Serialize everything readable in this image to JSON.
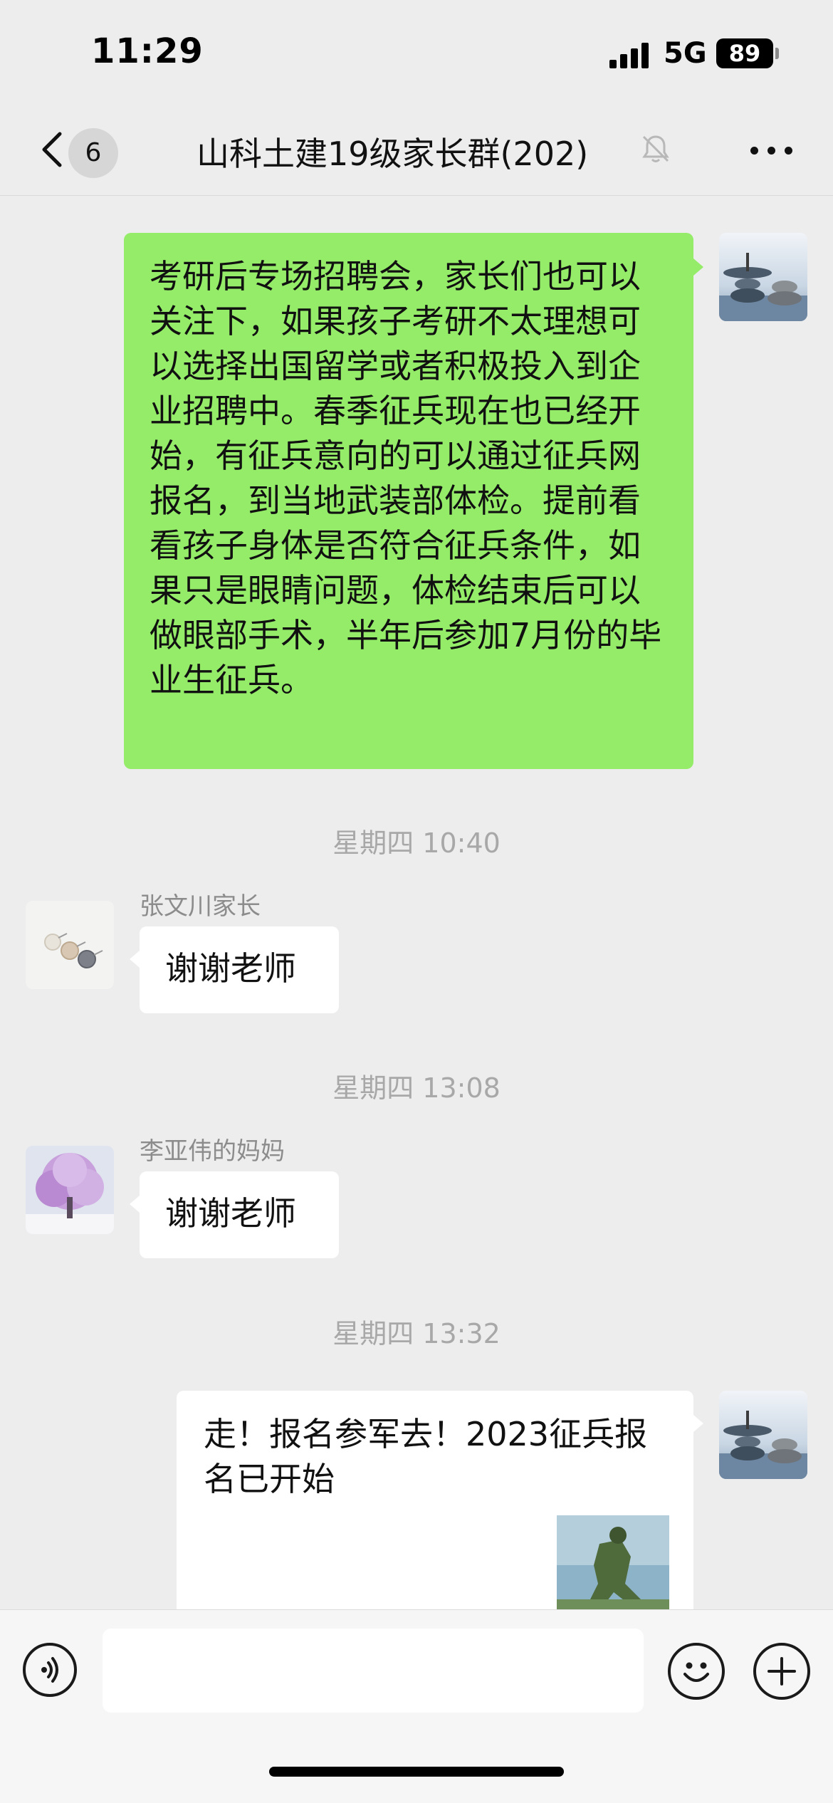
{
  "status_bar": {
    "time": "11:29",
    "network": "5G",
    "battery": "89"
  },
  "header": {
    "unread_count": "6",
    "title": "山科土建19级家长群(202)",
    "muted": true
  },
  "messages": [
    {
      "side": "right",
      "avatar": "stacked-stones-avatar",
      "text": "考研后专场招聘会，家长们也可以关注下，如果孩子考研不太理想可以选择出国留学或者积极投入到企业招聘中。春季征兵现在也已经开始，有征兵意向的可以通过征兵网报名，到当地武装部体检。提前看看孩子身体是否符合征兵条件，如果只是眼睛问题，体检结束后可以做眼部手术，半年后参加7月份的毕业生征兵。"
    },
    {
      "type": "time",
      "text": "星期四 10:40"
    },
    {
      "side": "left",
      "sender": "张文川家长",
      "avatar": "pearl-earrings-avatar",
      "text": "谢谢老师"
    },
    {
      "type": "time",
      "text": "星期四 13:08"
    },
    {
      "side": "left",
      "sender": "李亚伟的妈妈",
      "avatar": "purple-tree-avatar",
      "text": "谢谢老师"
    },
    {
      "type": "time",
      "text": "星期四 13:32"
    },
    {
      "side": "right",
      "avatar": "stacked-stones-avatar",
      "type_detail": "link-card",
      "text": "走！报名参军去！2023征兵报名已开始",
      "thumbnail": "soldier-thumbnail"
    }
  ],
  "input": {
    "placeholder": ""
  },
  "icons": {
    "back": "chevron-left-icon",
    "mute": "bell-off-icon",
    "more": "more-dots-icon",
    "voice": "voice-icon",
    "emoji": "emoji-icon",
    "plus": "plus-icon"
  },
  "colors": {
    "own_bubble": "#95ec69",
    "other_bubble": "#ffffff",
    "background": "#ededed"
  }
}
